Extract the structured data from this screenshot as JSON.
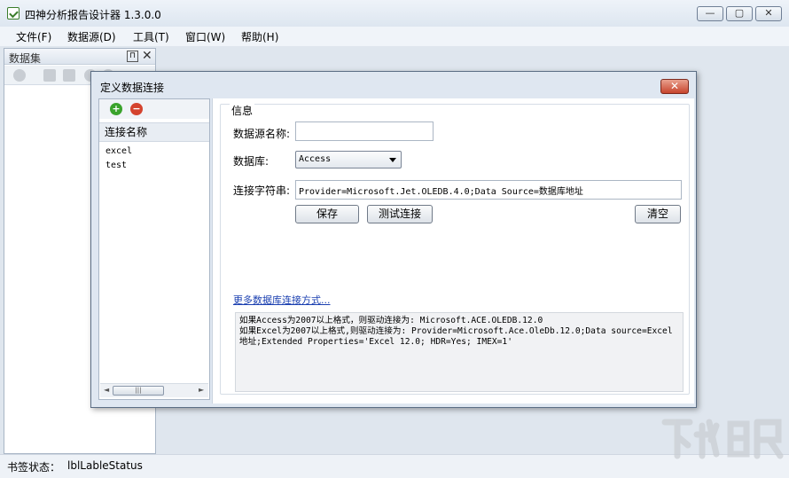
{
  "app": {
    "title": "四神分析报告设计器 1.3.0.0",
    "minimize_glyph": "—",
    "maximize_glyph": "▢",
    "close_glyph": "✕"
  },
  "menubar": {
    "items": [
      {
        "label": "文件(F)"
      },
      {
        "label": "数据源(D)"
      },
      {
        "label": "工具(T)"
      },
      {
        "label": "窗口(W)"
      },
      {
        "label": "帮助(H)"
      }
    ]
  },
  "dataset_panel": {
    "title": "数据集",
    "pin_glyph": "⊓",
    "close_glyph": "✕",
    "toolbar_icons": [
      "add-icon",
      "edit-icon",
      "copy-icon",
      "delete-icon",
      "refresh-icon"
    ]
  },
  "dialog": {
    "title": "定义数据连接",
    "close_glyph": "✕",
    "add_glyph": "+",
    "remove_glyph": "−",
    "connection_list": {
      "header": "连接名称",
      "items": [
        "excel",
        "test"
      ],
      "scroll_left_glyph": "◄",
      "scroll_right_glyph": "►",
      "scroll_thumb_glyph": "|||"
    },
    "info": {
      "group_title": "信息",
      "datasource_label": "数据源名称:",
      "datasource_value": "",
      "database_label": "数据库:",
      "database_selected": "Access",
      "connstr_label": "连接字符串:",
      "connstr_value": "Provider=Microsoft.Jet.OLEDB.4.0;Data Source=数据库地址",
      "save_button": "保存",
      "test_button": "测试连接",
      "clear_button": "清空",
      "more_link": "更多数据库连接方式...",
      "notes": "如果Access为2007以上格式，则驱动连接为: Microsoft.ACE.OLEDB.12.0\n如果Excel为2007以上格式,则驱动连接为: Provider=Microsoft.Ace.OleDb.12.0;Data source=Excel地址;Extended Properties='Excel 12.0; HDR=Yes; IMEX=1'"
    }
  },
  "statusbar": {
    "label": "书签状态：",
    "value": "lblLableStatus"
  },
  "colors": {
    "add_green": "#3aa32c",
    "remove_red": "#d4432e",
    "link_blue": "#1a3fb0"
  }
}
